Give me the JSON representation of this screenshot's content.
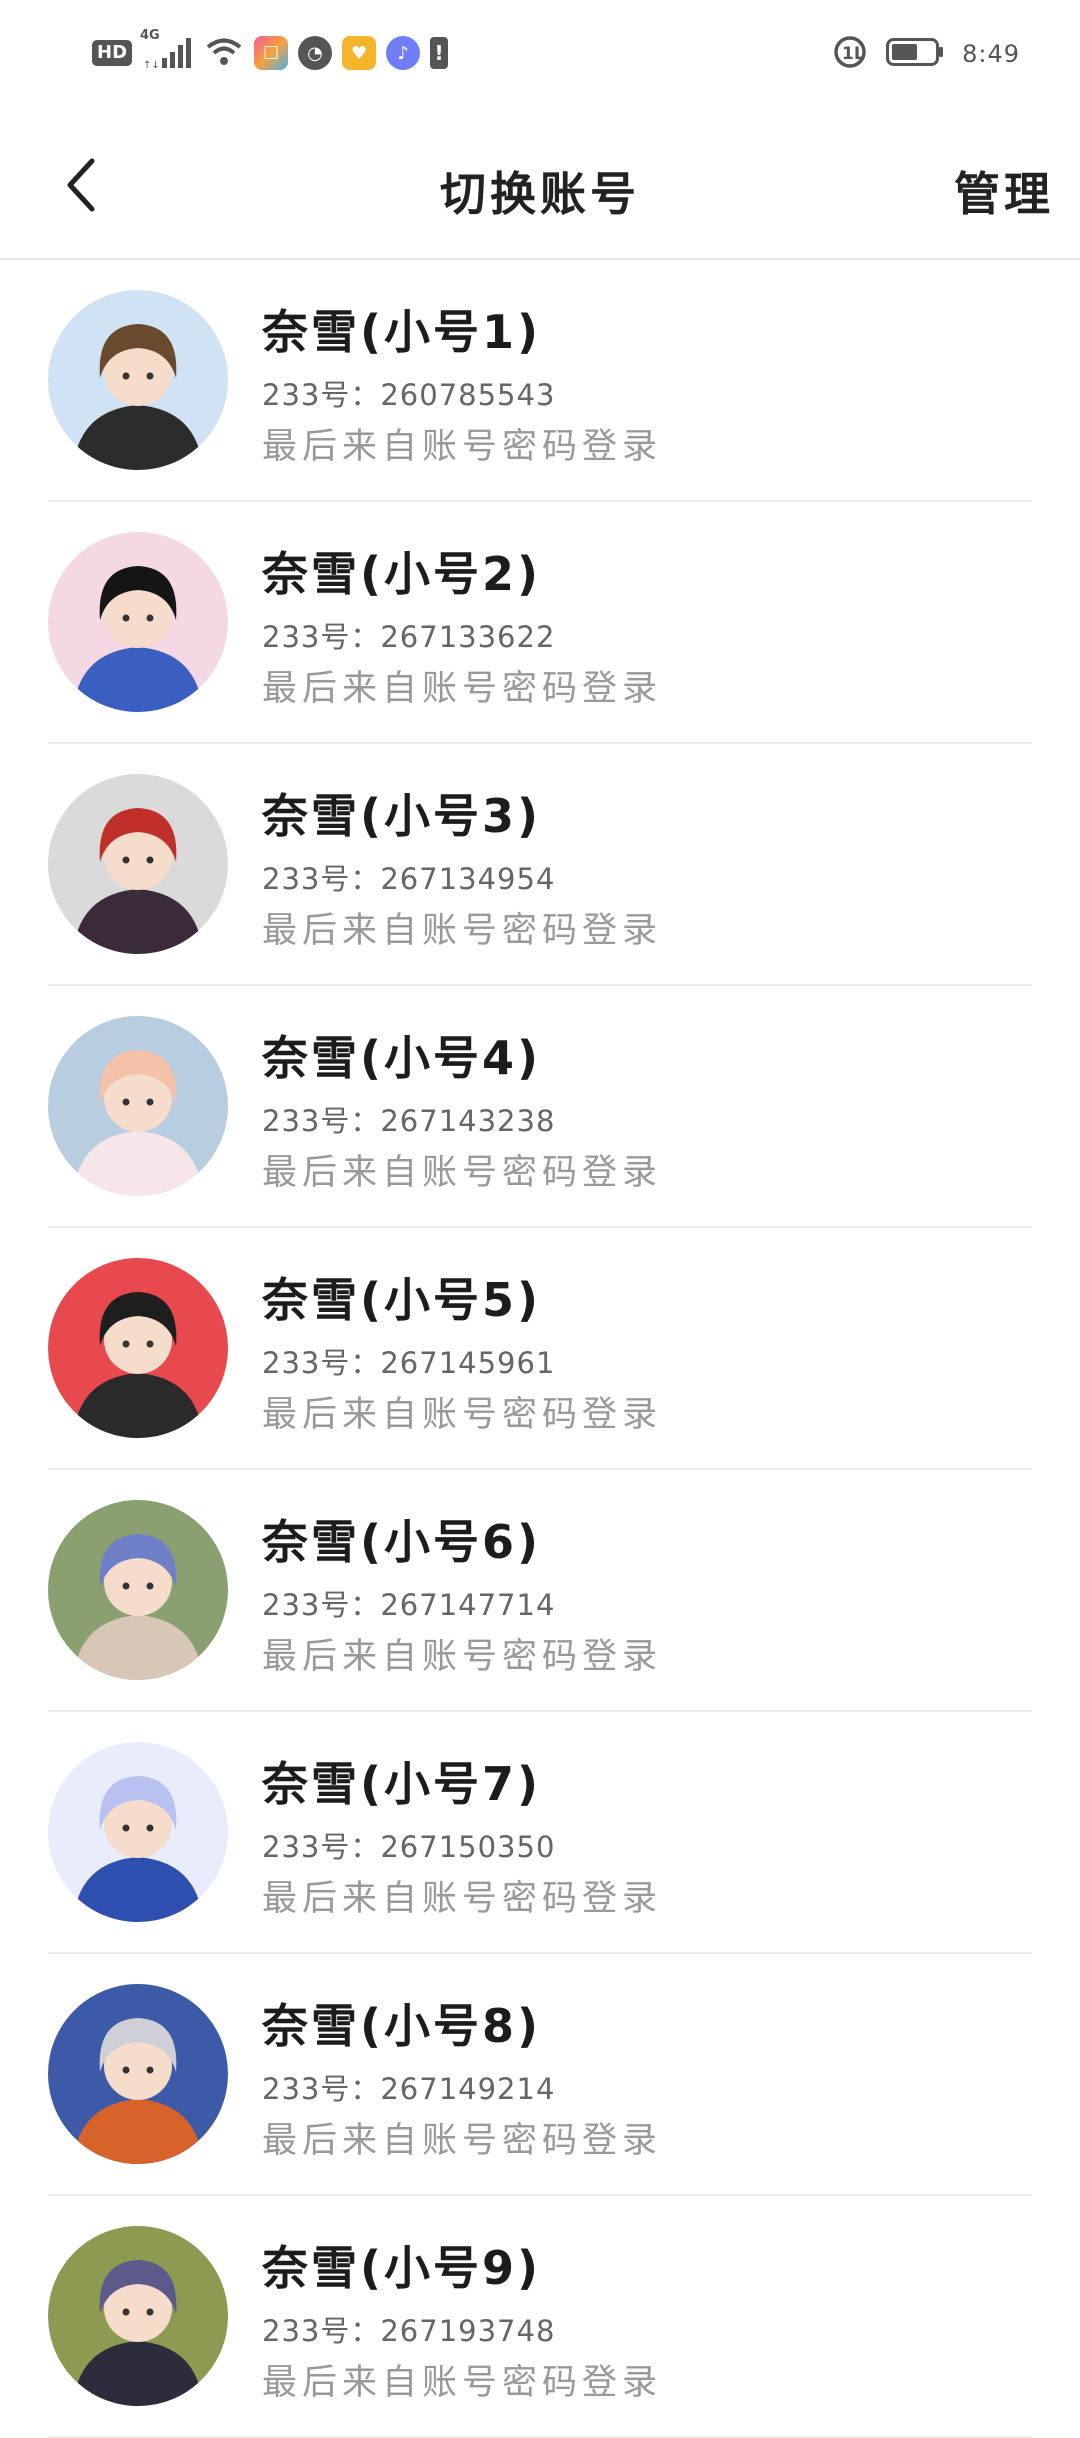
{
  "status_bar": {
    "hd": "HD",
    "network": "4G",
    "time": "8:49",
    "battery_level": 0.6
  },
  "nav": {
    "title": "切换账号",
    "manage": "管理"
  },
  "accounts": [
    {
      "name": "奈雪(小号1)",
      "id": "233号：260785543",
      "login": "最后来自账号密码登录",
      "bg": "#cfe3f4",
      "hair": "#6a4a2e",
      "cloth": "#2c2c2c"
    },
    {
      "name": "奈雪(小号2)",
      "id": "233号：267133622",
      "login": "最后来自账号密码登录",
      "bg": "#f4d9e4",
      "hair": "#151515",
      "cloth": "#3a5fc0"
    },
    {
      "name": "奈雪(小号3)",
      "id": "233号：267134954",
      "login": "最后来自账号密码登录",
      "bg": "#dadada",
      "hair": "#c0302a",
      "cloth": "#3a2a3a"
    },
    {
      "name": "奈雪(小号4)",
      "id": "233号：267143238",
      "login": "最后来自账号密码登录",
      "bg": "#b9cde0",
      "hair": "#f4c2a8",
      "cloth": "#f6e6ea"
    },
    {
      "name": "奈雪(小号5)",
      "id": "233号：267145961",
      "login": "最后来自账号密码登录",
      "bg": "#e8494e",
      "hair": "#1e1e1e",
      "cloth": "#2a2a2a"
    },
    {
      "name": "奈雪(小号6)",
      "id": "233号：267147714",
      "login": "最后来自账号密码登录",
      "bg": "#8aa070",
      "hair": "#6f7fc8",
      "cloth": "#d8c6b6"
    },
    {
      "name": "奈雪(小号7)",
      "id": "233号：267150350",
      "login": "最后来自账号密码登录",
      "bg": "#e9ecfb",
      "hair": "#b9c1f0",
      "cloth": "#2e4fb0"
    },
    {
      "name": "奈雪(小号8)",
      "id": "233号：267149214",
      "login": "最后来自账号密码登录",
      "bg": "#3d5aa8",
      "hair": "#cfcfd8",
      "cloth": "#d8632a"
    },
    {
      "name": "奈雪(小号9)",
      "id": "233号：267193748",
      "login": "最后来自账号密码登录",
      "bg": "#8c9a52",
      "hair": "#5b5a8a",
      "cloth": "#2c2c3c"
    }
  ]
}
